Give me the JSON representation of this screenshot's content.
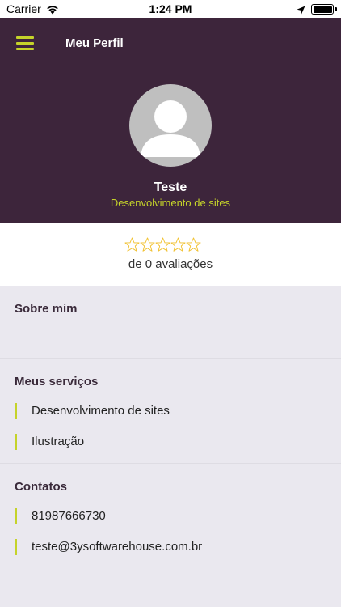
{
  "status": {
    "carrier": "Carrier",
    "time": "1:24 PM"
  },
  "header": {
    "title": "Meu Perfil",
    "menu_icon": "menu-icon"
  },
  "profile": {
    "name": "Teste",
    "role": "Desenvolvimento de sites"
  },
  "rating": {
    "stars_filled": 0,
    "stars_total": 5,
    "text": "de 0 avaliações"
  },
  "about": {
    "title": "Sobre mim"
  },
  "services": {
    "title": "Meus serviços",
    "items": [
      "Desenvolvimento de sites",
      "Ilustração"
    ]
  },
  "contacts": {
    "title": "Contatos",
    "items": [
      "81987666730",
      "teste@3ysoftwarehouse.com.br"
    ]
  },
  "colors": {
    "header_bg": "#3d253b",
    "accent": "#c5d32a",
    "star_outline": "#f1c232",
    "page_bg": "#eae8ef"
  }
}
